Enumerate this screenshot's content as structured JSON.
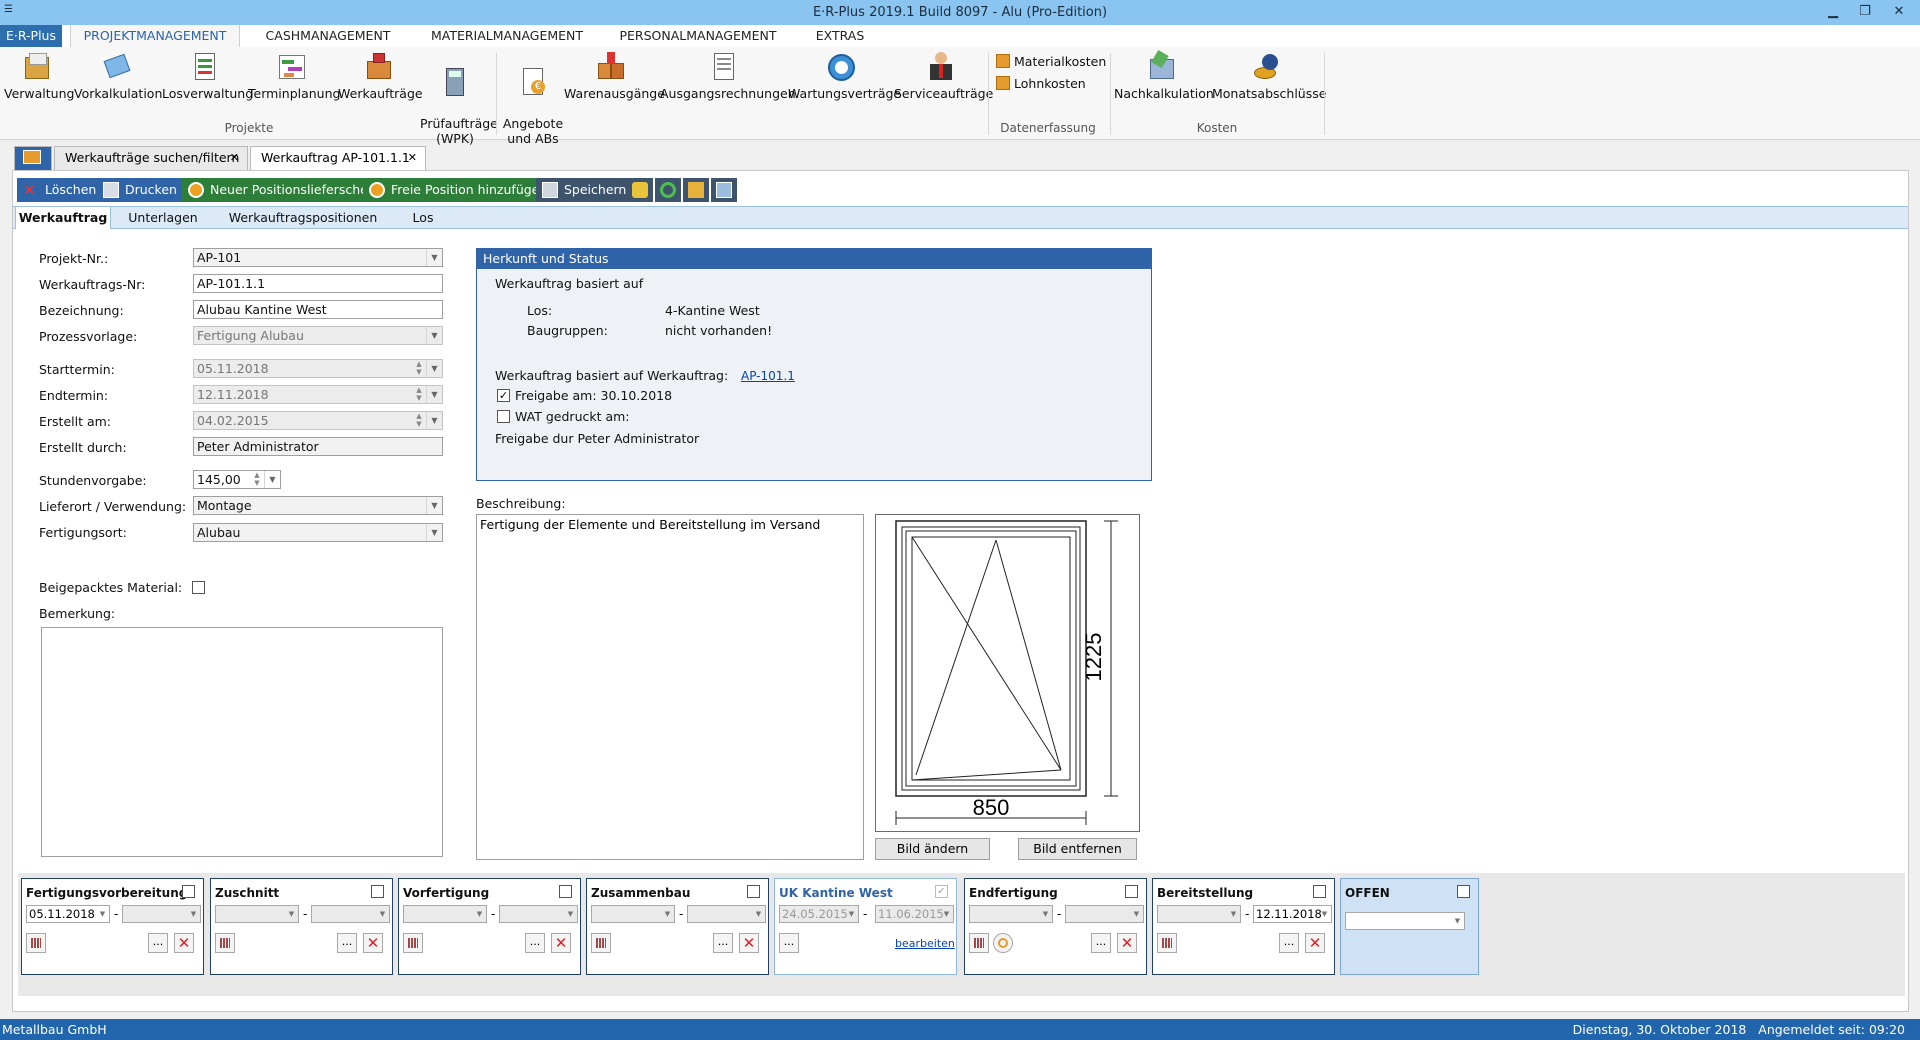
{
  "window": {
    "title": "E·R-Plus 2019.1 Build 8097 -  Alu (Pro-Edition)"
  },
  "menu": {
    "app": "E·R-Plus",
    "tabs": [
      "PROJEKTMANAGEMENT",
      "CASHMANAGEMENT",
      "MATERIALMANAGEMENT",
      "PERSONALMANAGEMENT",
      "EXTRAS"
    ]
  },
  "ribbon": {
    "projekte": {
      "label": "Projekte",
      "buttons": [
        "Verwaltung",
        "Vorkalkulation",
        "Losverwaltung",
        "Terminplanung",
        "Werkaufträge",
        "Prüfaufträge\n(WPK)",
        "Angebote\nund ABs",
        "Warenausgänge",
        "Ausgangsrechnungen",
        "Wartungsverträge",
        "Serviceaufträge"
      ]
    },
    "datenerfassung": {
      "label": "Datenerfassung",
      "buttons": [
        "Materialkosten",
        "Lohnkosten"
      ]
    },
    "kosten": {
      "label": "Kosten",
      "buttons": [
        "Nachkalkulation",
        "Monatsabschlüsse"
      ]
    }
  },
  "doctabs": {
    "search": "Werkaufträge suchen/filtern",
    "current": "Werkauftrag AP-101.1.1"
  },
  "toolbar": {
    "delete": "Löschen",
    "print": "Drucken",
    "new_delivery": "Neuer Positionslieferschein",
    "add_free_pos": "Freie Position hinzufügen",
    "save": "Speichern"
  },
  "subtabs": [
    "Werkauftrag",
    "Unterlagen",
    "Werkauftragspositionen",
    "Los"
  ],
  "form": {
    "projekt_nr": {
      "label": "Projekt-Nr.:",
      "value": "AP-101"
    },
    "werkauftrags_nr": {
      "label": "Werkauftrags-Nr:",
      "value": "AP-101.1.1"
    },
    "bezeichnung": {
      "label": "Bezeichnung:",
      "value": "Alubau Kantine West"
    },
    "prozessvorlage": {
      "label": "Prozessvorlage:",
      "value": "Fertigung Alubau"
    },
    "starttermin": {
      "label": "Starttermin:",
      "value": "05.11.2018"
    },
    "endtermin": {
      "label": "Endtermin:",
      "value": "12.11.2018"
    },
    "erstellt_am": {
      "label": "Erstellt am:",
      "value": "04.02.2015"
    },
    "erstellt_durch": {
      "label": "Erstellt durch:",
      "value": "Peter Administrator"
    },
    "stundenvorgabe": {
      "label": "Stundenvorgabe:",
      "value": "145,00"
    },
    "lieferort": {
      "label": "Lieferort / Verwendung:",
      "value": "Montage"
    },
    "fertigungsort": {
      "label": "Fertigungsort:",
      "value": "Alubau"
    },
    "beigepackt": {
      "label": "Beigepacktes Material:"
    },
    "bemerkung": {
      "label": "Bemerkung:"
    }
  },
  "herkunft": {
    "title": "Herkunft und Status",
    "basiert_auf": "Werkauftrag basiert auf",
    "los_label": "Los:",
    "los_value": "4-Kantine West",
    "baugruppen_label": "Baugruppen:",
    "baugruppen_value": "nicht vorhanden!",
    "basiert_wa_label": "Werkauftrag basiert auf Werkauftrag:",
    "basiert_wa_link": "AP-101.1",
    "freigabe": "Freigabe am: 30.10.2018",
    "wat": "WAT gedruckt am:",
    "freigabe_durch": "Freigabe dur Peter Administrator"
  },
  "beschreibung": {
    "label": "Beschreibung:",
    "text": "Fertigung der Elemente und Bereitstellung im Versand"
  },
  "drawing": {
    "height": "1225",
    "width": "850"
  },
  "image_buttons": {
    "change": "Bild ändern",
    "remove": "Bild entfernen"
  },
  "stages": [
    {
      "title": "Fertigungsvorbereitung",
      "start": "05.11.2018",
      "end": "",
      "checked": false
    },
    {
      "title": "Zuschnitt",
      "start": "",
      "end": "",
      "checked": false
    },
    {
      "title": "Vorfertigung",
      "start": "",
      "end": "",
      "checked": false
    },
    {
      "title": "Zusammenbau",
      "start": "",
      "end": "",
      "checked": false
    },
    {
      "title": "UK Kantine West",
      "start": "24.05.2015",
      "end": "11.06.2015",
      "checked": true,
      "link": "bearbeiten"
    },
    {
      "title": "Endfertigung",
      "start": "",
      "end": "",
      "checked": false
    },
    {
      "title": "Bereitstellung",
      "start": "",
      "end": "12.11.2018",
      "checked": false
    },
    {
      "title": "OFFEN",
      "checked": false
    }
  ],
  "status": {
    "company": "Metallbau GmbH",
    "datetime": "Dienstag, 30. Oktober 2018   Angemeldet seit: 09:20"
  },
  "colors": {
    "accent": "#2f64a8",
    "titlebar": "#89c5f0",
    "statusbar": "#2166ad",
    "green": "#2d7e38"
  }
}
